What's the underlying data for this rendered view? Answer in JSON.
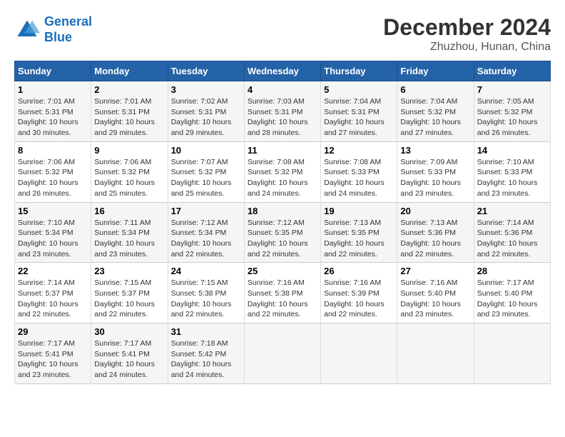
{
  "header": {
    "logo_line1": "General",
    "logo_line2": "Blue",
    "month": "December 2024",
    "location": "Zhuzhou, Hunan, China"
  },
  "weekdays": [
    "Sunday",
    "Monday",
    "Tuesday",
    "Wednesday",
    "Thursday",
    "Friday",
    "Saturday"
  ],
  "weeks": [
    [
      {
        "day": "1",
        "sunrise": "7:01 AM",
        "sunset": "5:31 PM",
        "daylight": "10 hours and 30 minutes."
      },
      {
        "day": "2",
        "sunrise": "7:01 AM",
        "sunset": "5:31 PM",
        "daylight": "10 hours and 29 minutes."
      },
      {
        "day": "3",
        "sunrise": "7:02 AM",
        "sunset": "5:31 PM",
        "daylight": "10 hours and 29 minutes."
      },
      {
        "day": "4",
        "sunrise": "7:03 AM",
        "sunset": "5:31 PM",
        "daylight": "10 hours and 28 minutes."
      },
      {
        "day": "5",
        "sunrise": "7:04 AM",
        "sunset": "5:31 PM",
        "daylight": "10 hours and 27 minutes."
      },
      {
        "day": "6",
        "sunrise": "7:04 AM",
        "sunset": "5:32 PM",
        "daylight": "10 hours and 27 minutes."
      },
      {
        "day": "7",
        "sunrise": "7:05 AM",
        "sunset": "5:32 PM",
        "daylight": "10 hours and 26 minutes."
      }
    ],
    [
      {
        "day": "8",
        "sunrise": "7:06 AM",
        "sunset": "5:32 PM",
        "daylight": "10 hours and 26 minutes."
      },
      {
        "day": "9",
        "sunrise": "7:06 AM",
        "sunset": "5:32 PM",
        "daylight": "10 hours and 25 minutes."
      },
      {
        "day": "10",
        "sunrise": "7:07 AM",
        "sunset": "5:32 PM",
        "daylight": "10 hours and 25 minutes."
      },
      {
        "day": "11",
        "sunrise": "7:08 AM",
        "sunset": "5:32 PM",
        "daylight": "10 hours and 24 minutes."
      },
      {
        "day": "12",
        "sunrise": "7:08 AM",
        "sunset": "5:33 PM",
        "daylight": "10 hours and 24 minutes."
      },
      {
        "day": "13",
        "sunrise": "7:09 AM",
        "sunset": "5:33 PM",
        "daylight": "10 hours and 23 minutes."
      },
      {
        "day": "14",
        "sunrise": "7:10 AM",
        "sunset": "5:33 PM",
        "daylight": "10 hours and 23 minutes."
      }
    ],
    [
      {
        "day": "15",
        "sunrise": "7:10 AM",
        "sunset": "5:34 PM",
        "daylight": "10 hours and 23 minutes."
      },
      {
        "day": "16",
        "sunrise": "7:11 AM",
        "sunset": "5:34 PM",
        "daylight": "10 hours and 23 minutes."
      },
      {
        "day": "17",
        "sunrise": "7:12 AM",
        "sunset": "5:34 PM",
        "daylight": "10 hours and 22 minutes."
      },
      {
        "day": "18",
        "sunrise": "7:12 AM",
        "sunset": "5:35 PM",
        "daylight": "10 hours and 22 minutes."
      },
      {
        "day": "19",
        "sunrise": "7:13 AM",
        "sunset": "5:35 PM",
        "daylight": "10 hours and 22 minutes."
      },
      {
        "day": "20",
        "sunrise": "7:13 AM",
        "sunset": "5:36 PM",
        "daylight": "10 hours and 22 minutes."
      },
      {
        "day": "21",
        "sunrise": "7:14 AM",
        "sunset": "5:36 PM",
        "daylight": "10 hours and 22 minutes."
      }
    ],
    [
      {
        "day": "22",
        "sunrise": "7:14 AM",
        "sunset": "5:37 PM",
        "daylight": "10 hours and 22 minutes."
      },
      {
        "day": "23",
        "sunrise": "7:15 AM",
        "sunset": "5:37 PM",
        "daylight": "10 hours and 22 minutes."
      },
      {
        "day": "24",
        "sunrise": "7:15 AM",
        "sunset": "5:38 PM",
        "daylight": "10 hours and 22 minutes."
      },
      {
        "day": "25",
        "sunrise": "7:16 AM",
        "sunset": "5:38 PM",
        "daylight": "10 hours and 22 minutes."
      },
      {
        "day": "26",
        "sunrise": "7:16 AM",
        "sunset": "5:39 PM",
        "daylight": "10 hours and 22 minutes."
      },
      {
        "day": "27",
        "sunrise": "7:16 AM",
        "sunset": "5:40 PM",
        "daylight": "10 hours and 23 minutes."
      },
      {
        "day": "28",
        "sunrise": "7:17 AM",
        "sunset": "5:40 PM",
        "daylight": "10 hours and 23 minutes."
      }
    ],
    [
      {
        "day": "29",
        "sunrise": "7:17 AM",
        "sunset": "5:41 PM",
        "daylight": "10 hours and 23 minutes."
      },
      {
        "day": "30",
        "sunrise": "7:17 AM",
        "sunset": "5:41 PM",
        "daylight": "10 hours and 24 minutes."
      },
      {
        "day": "31",
        "sunrise": "7:18 AM",
        "sunset": "5:42 PM",
        "daylight": "10 hours and 24 minutes."
      },
      null,
      null,
      null,
      null
    ]
  ]
}
